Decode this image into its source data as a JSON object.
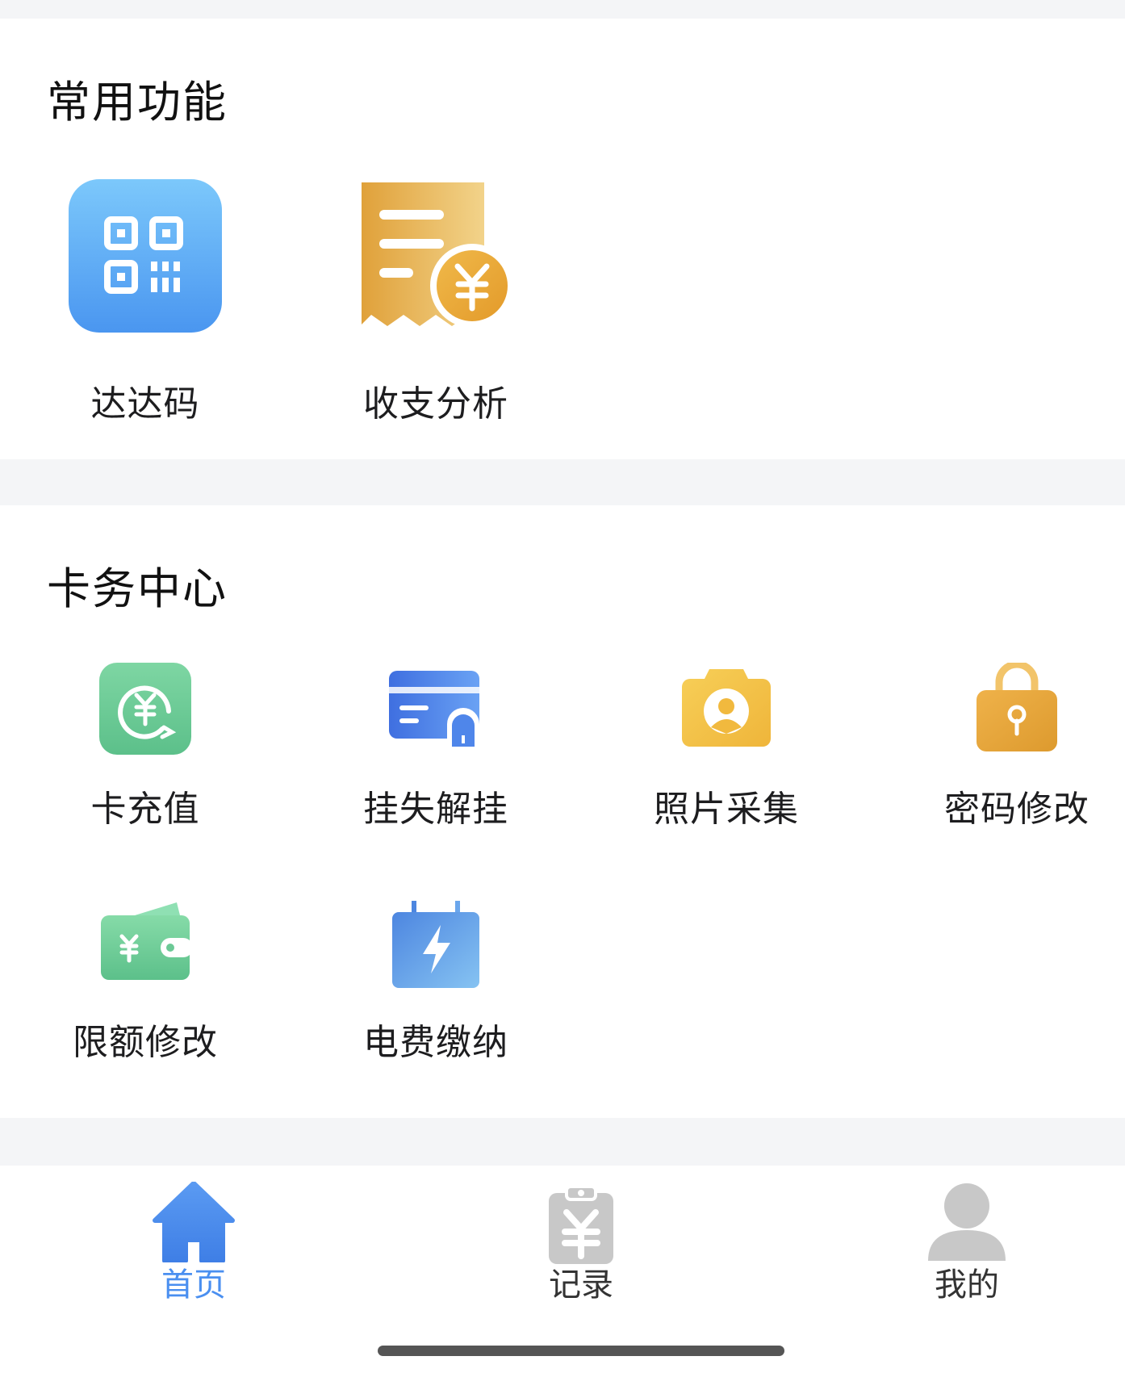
{
  "sections": {
    "common": {
      "title": "常用功能",
      "items": [
        {
          "label": "达达码",
          "icon": "qr-code-icon"
        },
        {
          "label": "收支分析",
          "icon": "receipt-yuan-icon"
        }
      ]
    },
    "card": {
      "title": "卡务中心",
      "items": [
        {
          "label": "卡充值",
          "icon": "yuan-recharge-icon"
        },
        {
          "label": "挂失解挂",
          "icon": "card-lock-icon"
        },
        {
          "label": "照片采集",
          "icon": "camera-portrait-icon"
        },
        {
          "label": "密码修改",
          "icon": "padlock-icon"
        },
        {
          "label": "限额修改",
          "icon": "wallet-icon"
        },
        {
          "label": "电费缴纳",
          "icon": "lightning-battery-icon"
        }
      ]
    }
  },
  "tabbar": {
    "tabs": [
      {
        "label": "首页",
        "icon": "home-icon",
        "active": true
      },
      {
        "label": "记录",
        "icon": "clipboard-yuan-icon",
        "active": false
      },
      {
        "label": "我的",
        "icon": "user-icon",
        "active": false
      }
    ]
  },
  "colors": {
    "active_tab": "#4a8ff0",
    "inactive_icon": "#c8c8c8",
    "background": "#f4f5f7"
  }
}
